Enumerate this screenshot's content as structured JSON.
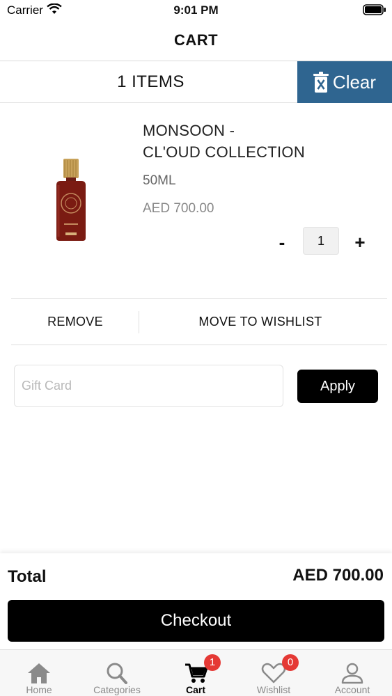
{
  "status_bar": {
    "carrier": "Carrier",
    "time": "9:01 PM"
  },
  "header": {
    "title": "CART"
  },
  "cart_bar": {
    "items_count": "1 ITEMS",
    "clear_label": "Clear"
  },
  "product": {
    "name": "MONSOON -\nCL'OUD COLLECTION",
    "size": "50ML",
    "price": "AED 700.00",
    "quantity": "1",
    "minus_label": "-",
    "plus_label": "+"
  },
  "actions": {
    "remove_label": "REMOVE",
    "wishlist_label": "MOVE TO WISHLIST"
  },
  "gift_card": {
    "placeholder": "Gift Card",
    "value": "",
    "apply_label": "Apply"
  },
  "summary": {
    "total_label": "Total",
    "total_value": "AED 700.00",
    "checkout_label": "Checkout"
  },
  "tabs": [
    {
      "label": "Home",
      "icon": "home-icon"
    },
    {
      "label": "Categories",
      "icon": "search-icon"
    },
    {
      "label": "Cart",
      "icon": "cart-icon",
      "badge": "1",
      "active": true
    },
    {
      "label": "Wishlist",
      "icon": "heart-icon",
      "badge": "0"
    },
    {
      "label": "Account",
      "icon": "user-icon"
    }
  ],
  "colors": {
    "accent": "#2f6590",
    "badge": "#e53935",
    "primary_button": "#000000"
  }
}
